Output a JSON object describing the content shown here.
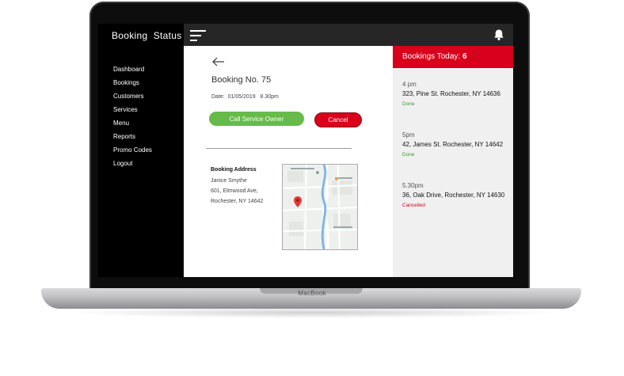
{
  "device": {
    "brand": "MacBook"
  },
  "app": {
    "title": "Booking  Status"
  },
  "sidebar": {
    "items": [
      {
        "label": "Dashboard"
      },
      {
        "label": "Bookings"
      },
      {
        "label": "Customers"
      },
      {
        "label": "Services"
      },
      {
        "label": "Menu"
      },
      {
        "label": "Reports"
      },
      {
        "label": "Promo Codes"
      },
      {
        "label": "Logout"
      }
    ]
  },
  "topbar": {
    "menu_icon": "hamburger-icon",
    "notification_icon": "bell-icon"
  },
  "booking": {
    "back_icon": "arrow-left-icon",
    "number": "Booking No. 75",
    "date": "Date:  01/05/2019   8.30pm",
    "call_button": "Call Service Owner",
    "cancel_button": "Cancel",
    "address_title": "Booking Address",
    "address_lines": [
      "Janice Smythe",
      "601, Elmwood Ave,",
      "Rochester, NY 14642"
    ]
  },
  "bookings_today": {
    "label": "Bookings Today:",
    "count": "6",
    "entries": [
      {
        "time": "4 pm",
        "address": "323, Pine St. Rochester, NY 14636",
        "status": "Done"
      },
      {
        "time": "5pm",
        "address": "42, James St. Rochester, NY 14642",
        "status": "Done"
      },
      {
        "time": "5.30pm",
        "address": "36, Oak Drive, Rochester, NY 14630",
        "status": "Cancelled"
      }
    ]
  },
  "colors": {
    "accent_red": "#d9001b",
    "accent_green": "#66bb4a",
    "status_done": "#3e9b2e",
    "topbar": "#262626"
  }
}
